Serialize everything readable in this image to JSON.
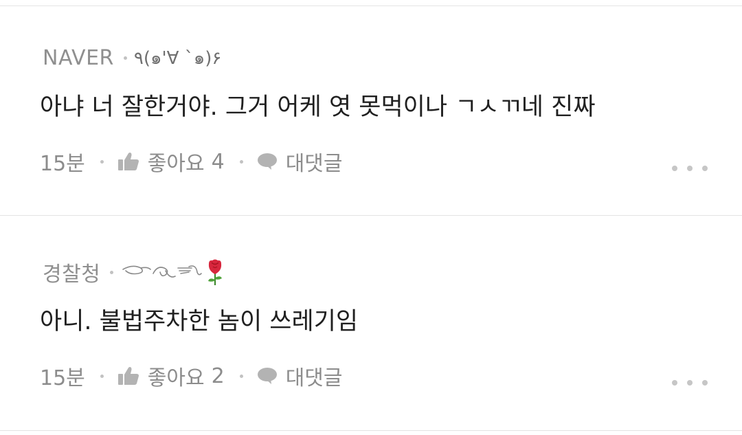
{
  "comments": [
    {
      "author": "NAVER",
      "nickname": "٩(๑'∀ `๑)۶",
      "text": "아냐 너 잘한거야. 그거 어케 엿 못먹이나 ㄱㅅㄲ네 진짜",
      "time": "15분",
      "like_label": "좋아요",
      "like_count": "4",
      "reply_label": "대댓글"
    },
    {
      "author": "경찰청",
      "nickname": "",
      "nickname_emoji": "rose-emoji",
      "text": "아니. 불법주차한 놈이 쓰레기임",
      "time": "15분",
      "like_label": "좋아요",
      "like_count": "2",
      "reply_label": "대댓글"
    }
  ],
  "icons": {
    "like": "thumbs-up-icon",
    "reply": "speech-bubble-icon",
    "more": "more-dots-icon"
  },
  "colors": {
    "divider": "#e4e4e4",
    "meta_text": "#8c8c8c",
    "body_text": "#202020",
    "icon": "#b3b3b3",
    "rose": "#d7263d"
  }
}
